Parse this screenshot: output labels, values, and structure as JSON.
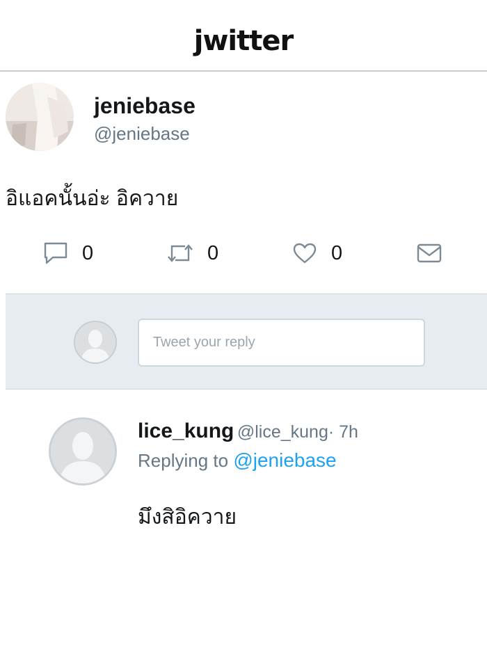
{
  "app": {
    "logo": "jwitter"
  },
  "tweet": {
    "author_name": "jeniebase",
    "author_handle": "@jeniebase",
    "text": "อิแอคนั้นอ่ะ อิควาย",
    "actions": {
      "replies": "0",
      "retweets": "0",
      "likes": "0"
    }
  },
  "reply_box": {
    "placeholder": "Tweet your reply"
  },
  "reply": {
    "author_name": "lice_kung",
    "author_handle": "@lice_kung",
    "time": "· 7h",
    "replying_label": "Replying to",
    "replying_to": "@jeniebase",
    "text": "มึงสิอิควาย"
  },
  "colors": {
    "link": "#1da1f2",
    "muted": "#657786",
    "reply_bar": "#e6ecf0"
  },
  "icons": [
    "reply-icon",
    "retweet-icon",
    "like-icon",
    "message-icon",
    "default-avatar-icon"
  ]
}
